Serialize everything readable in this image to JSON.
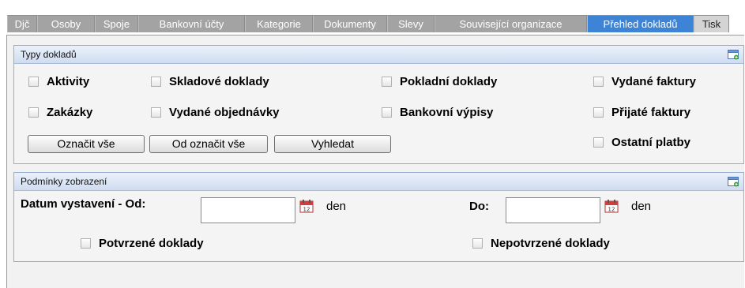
{
  "tabs": [
    {
      "label": "Djč"
    },
    {
      "label": "Osoby"
    },
    {
      "label": "Spoje"
    },
    {
      "label": "Bankovní účty"
    },
    {
      "label": "Kategorie"
    },
    {
      "label": "Dokumenty"
    },
    {
      "label": "Slevy"
    },
    {
      "label": "Související organizace"
    },
    {
      "label": "Přehled dokladů"
    },
    {
      "label": "Tisk"
    }
  ],
  "active_tab": "Přehled dokladů",
  "types_panel": {
    "title": "Typy dokladů",
    "checkboxes": [
      {
        "label": "Aktivity",
        "checked": false
      },
      {
        "label": "Skladové doklady",
        "checked": false
      },
      {
        "label": "Pokladní doklady",
        "checked": false
      },
      {
        "label": "Vydané faktury",
        "checked": false
      },
      {
        "label": "Zakázky",
        "checked": false
      },
      {
        "label": "Vydané objednávky",
        "checked": false
      },
      {
        "label": "Bankovní výpisy",
        "checked": false
      },
      {
        "label": "Přijaté faktury",
        "checked": false
      },
      {
        "label": "Ostatní platby",
        "checked": false
      }
    ],
    "buttons": {
      "select_all": "Označit vše",
      "deselect_all": "Od označit vše",
      "search": "Vyhledat"
    }
  },
  "conditions_panel": {
    "title": "Podmínky zobrazení",
    "date_from_label": "Datum vystavení - Od:",
    "date_from_value": "",
    "date_to_label": "Do:",
    "date_to_value": "",
    "unit": "den",
    "confirmed_label": "Potvrzené doklady",
    "confirmed_checked": false,
    "unconfirmed_label": "Nepotvrzené doklady",
    "unconfirmed_checked": false
  }
}
